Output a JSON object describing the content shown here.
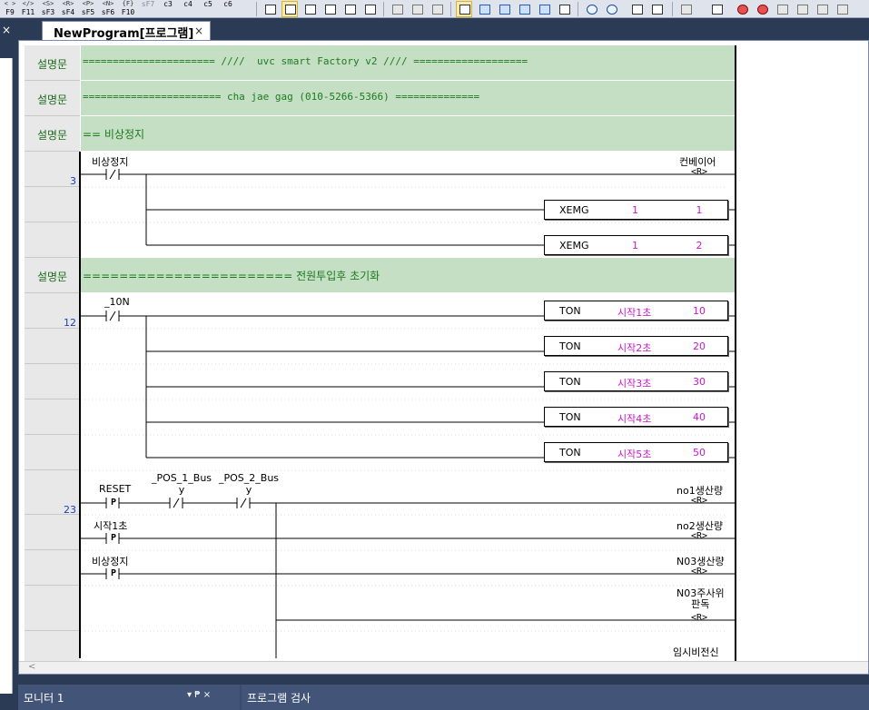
{
  "toolbar": {
    "fkeys": [
      {
        "sym": "< >",
        "label": "F9"
      },
      {
        "sym": "</>",
        "label": "F11"
      },
      {
        "sym": "<S>",
        "label": "sF3"
      },
      {
        "sym": "<R>",
        "label": "sF4"
      },
      {
        "sym": "<P>",
        "label": "sF5"
      },
      {
        "sym": "<N>",
        "label": "sF6"
      },
      {
        "sym": "{F}",
        "label": "F10"
      },
      {
        "sym": "",
        "label": "sF7"
      },
      {
        "sym": "",
        "label": "c3"
      },
      {
        "sym": "",
        "label": "c4"
      },
      {
        "sym": "",
        "label": "c5"
      },
      {
        "sym": "",
        "label": "c6"
      }
    ]
  },
  "left_strip": {
    "close": "×"
  },
  "tab": {
    "title": "NewProgram[프로그램]",
    "close": "×"
  },
  "ladder": {
    "comments": [
      "====================== ////  uvc smart Factory v2 //// ===================",
      "======================= cha jae gag (010-5266-5366) ==============",
      "== 비상정지",
      "======================= 전원투입후 초기화"
    ],
    "comment_label": "설명문",
    "rungs": [
      {
        "number": "3"
      },
      {
        "number": "12"
      },
      {
        "number": "23"
      }
    ],
    "rung3": {
      "contact": "비상정지",
      "coil": "컨베이어",
      "coil_type": "<R>",
      "boxes": [
        {
          "op": "XEMG",
          "a1": "1",
          "a2": "1"
        },
        {
          "op": "XEMG",
          "a1": "1",
          "a2": "2"
        }
      ]
    },
    "rung12": {
      "contact": "_10N",
      "boxes": [
        {
          "op": "TON",
          "a1": "시작1초",
          "a2": "10"
        },
        {
          "op": "TON",
          "a1": "시작2초",
          "a2": "20"
        },
        {
          "op": "TON",
          "a1": "시작3초",
          "a2": "30"
        },
        {
          "op": "TON",
          "a1": "시작4초",
          "a2": "40"
        },
        {
          "op": "TON",
          "a1": "시작5초",
          "a2": "50"
        }
      ]
    },
    "rung23": {
      "contacts": [
        {
          "label": "RESET",
          "type": "P"
        },
        {
          "label": "_POS_1_Bus\ny",
          "type": "/"
        },
        {
          "label": "_POS_2_Bus\ny",
          "type": "/"
        },
        {
          "label": "시작1초",
          "type": "P"
        },
        {
          "label": "비상정지",
          "type": "P"
        }
      ],
      "coils": [
        {
          "label": "no1생산량",
          "type": "<R>"
        },
        {
          "label": "no2생산량",
          "type": "<R>"
        },
        {
          "label": "N03생산량",
          "type": "<R>"
        },
        {
          "label": "N03주사위\n판독",
          "type": "<R>"
        },
        {
          "label": "임시비전신",
          "type": ""
        }
      ]
    }
  },
  "bottom": {
    "monitor_title": "모니터 1",
    "monitor_pin": "▾ ₱ ×",
    "search_title": "프로그램 검사"
  },
  "colors": {
    "comment_bg": "#c4dfc4",
    "comment_text": "#1d7a1d",
    "rung_number": "#1a3fbf",
    "operand_magenta": "#c818c8",
    "frame_dark": "#2b3a55"
  }
}
